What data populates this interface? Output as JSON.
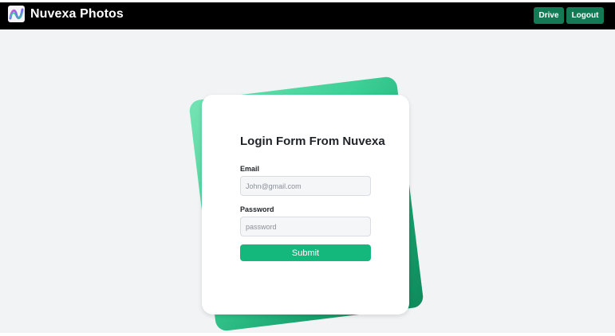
{
  "header": {
    "brand": "Nuvexa Photos",
    "logo_icon": "nuvexa-logo-icon",
    "nav": {
      "drive_label": "Drive",
      "logout_label": "Logout"
    },
    "background": "#000000",
    "button_color": "#137a55"
  },
  "form": {
    "title": "Login Form From Nuvexa",
    "email": {
      "label": "Email",
      "placeholder": "John@gmail.com",
      "value": ""
    },
    "password": {
      "label": "Password",
      "placeholder": "password",
      "value": ""
    },
    "submit_label": "Submit",
    "accent": "#14b87d"
  }
}
